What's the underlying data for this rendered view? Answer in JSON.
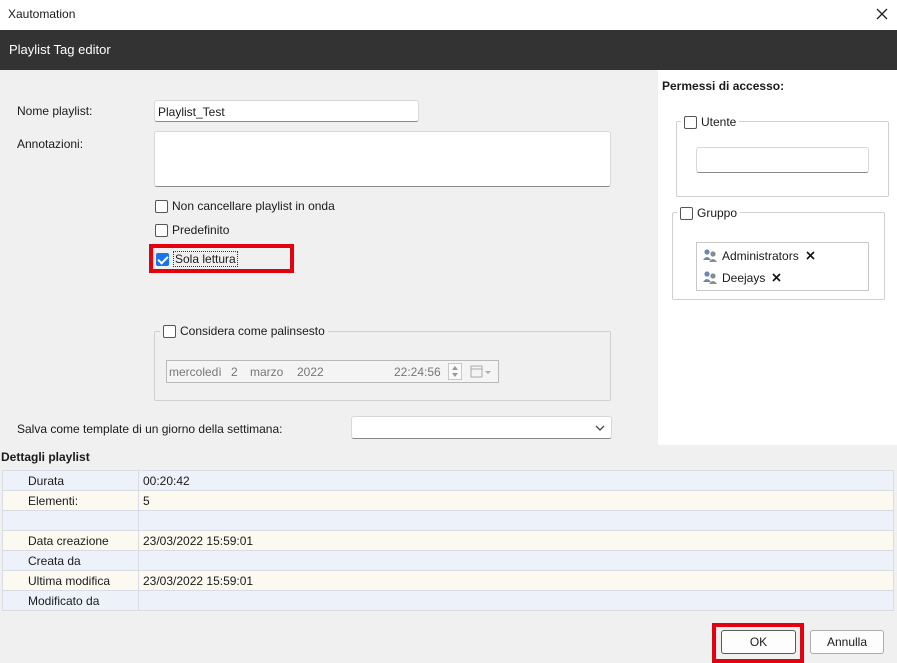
{
  "window": {
    "title": "Xautomation",
    "close_icon": "close-icon"
  },
  "header": {
    "title": "Playlist Tag editor"
  },
  "form": {
    "nome_label": "Nome playlist:",
    "nome_value": "Playlist_Test",
    "annotazioni_label": "Annotazioni:",
    "annotazioni_value": "",
    "chk_non_cancellare": {
      "label": "Non cancellare playlist in onda",
      "checked": false
    },
    "chk_predefinito": {
      "label": "Predefinito",
      "checked": false
    },
    "chk_sola_lettura": {
      "label": "Sola lettura",
      "checked": true
    },
    "palinsesto": {
      "label": "Considera come palinsesto",
      "checked": false,
      "date": {
        "weekday": "mercoledì",
        "day": "2",
        "month": "marzo",
        "year": "2022",
        "time": "22:24:56"
      }
    },
    "template_label": "Salva come template di un giorno della settimana:",
    "template_value": ""
  },
  "permessi": {
    "title": "Permessi di accesso:",
    "utente": {
      "label": "Utente",
      "checked": false,
      "value": ""
    },
    "gruppo": {
      "label": "Gruppo",
      "checked": false,
      "items": [
        {
          "name": "Administrators",
          "remove_icon": "remove-icon"
        },
        {
          "name": "Deejays",
          "remove_icon": "remove-icon"
        }
      ]
    }
  },
  "dettagli": {
    "title": "Dettagli playlist",
    "rows": [
      {
        "key": "Durata",
        "value": "00:20:42"
      },
      {
        "key": "Elementi:",
        "value": "5"
      },
      {
        "key": "",
        "value": ""
      },
      {
        "key": "Data creazione",
        "value": "23/03/2022 15:59:01"
      },
      {
        "key": "Creata da",
        "value": ""
      },
      {
        "key": "Ultima modifica",
        "value": "23/03/2022 15:59:01"
      },
      {
        "key": "Modificato da",
        "value": ""
      }
    ]
  },
  "buttons": {
    "ok": "OK",
    "annulla": "Annulla"
  },
  "colors": {
    "header_bg": "#333333",
    "highlight": "#e3000f",
    "check_accent": "#1a73e8",
    "row_even": "#edf2fa",
    "row_odd": "#fbf9f0"
  }
}
